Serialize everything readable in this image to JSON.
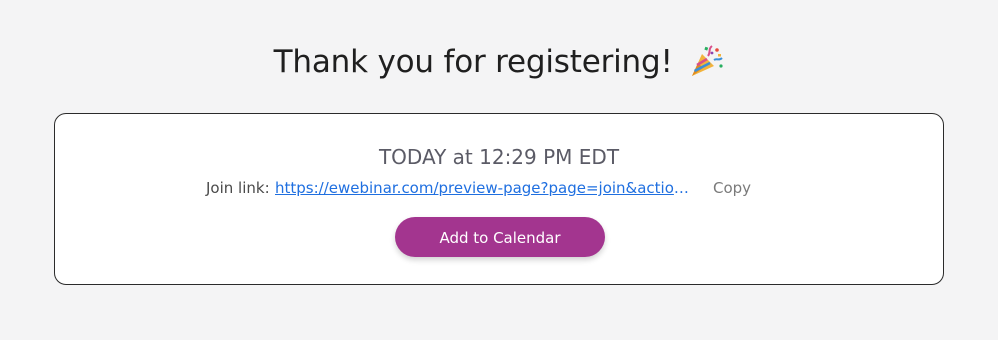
{
  "header": {
    "title": "Thank you for registering!",
    "emoji_icon": "party-popper-icon"
  },
  "card": {
    "datetime": "TODAY at 12:29 PM EDT",
    "join_label": "Join link:",
    "join_url": "https://ewebinar.com/preview-page?page=join&action=...",
    "copy_label": "Copy",
    "calendar_button_label": "Add to Calendar"
  },
  "colors": {
    "accent": "#a3358f",
    "link": "#1f6fe0",
    "background": "#f4f4f5"
  }
}
